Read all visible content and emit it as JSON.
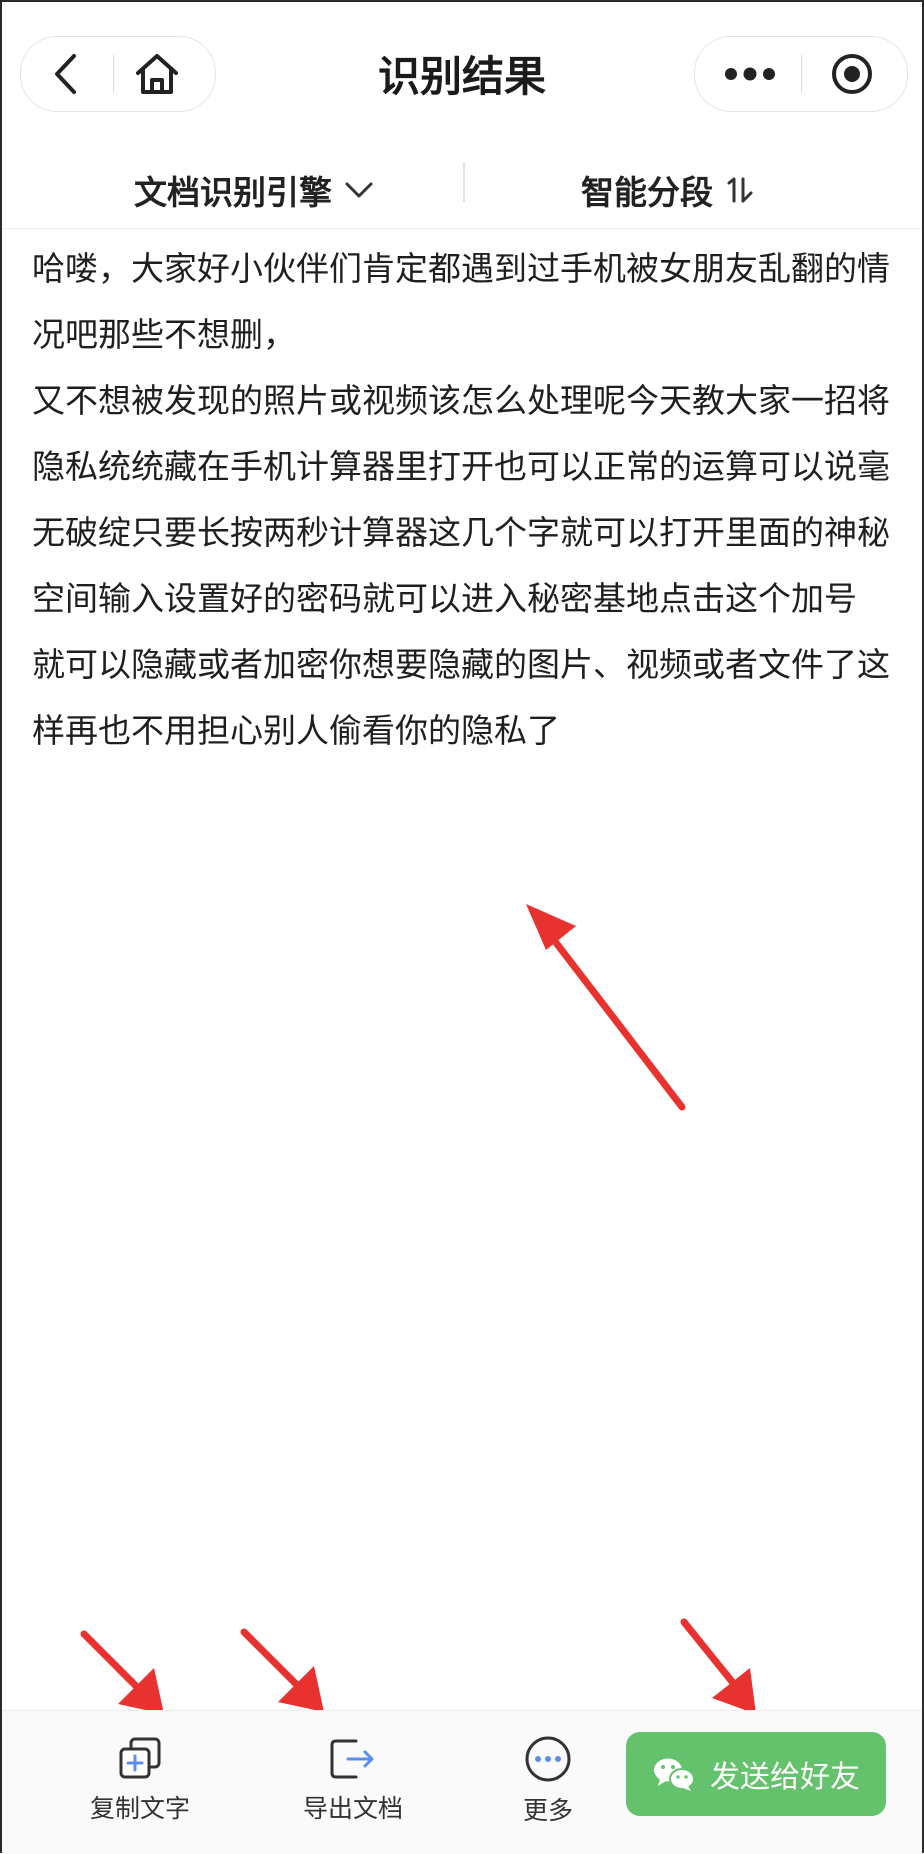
{
  "header": {
    "title": "识别结果",
    "left_icons": [
      "back-arrow-icon",
      "home-icon"
    ],
    "right_icons": [
      "more-dots-icon",
      "target-icon"
    ]
  },
  "toolbar": {
    "engine_label": "文档识别引擎",
    "engine_icon": "chevron-down-icon",
    "segment_label": "智能分段",
    "segment_icon": "sort-toggle-icon"
  },
  "content": {
    "paragraphs": [
      "哈喽，大家好小伙伴们肯定都遇到过手机被女朋友乱翻的情况吧那些不想删，",
      "又不想被发现的照片或视频该怎么处理呢今天教大家一招将隐私统统藏在手机计算器里打开也可以正常的运算可以说毫无破绽只要长按两秒计算器这几个字就可以打开里面的神秘空间输入设置好的密码就可以进入秘密基地点击这个加号",
      "就可以隐藏或者加密你想要隐藏的图片、视频或者文件了这样再也不用担心别人偷看你的隐私了"
    ]
  },
  "bottom_bar": {
    "copy_label": "复制文字",
    "copy_icon": "copy-plus-icon",
    "export_label": "导出文档",
    "export_icon": "export-doc-icon",
    "more_label": "更多",
    "more_icon": "more-circle-icon",
    "send_label": "发送给好友",
    "send_icon": "wechat-icon"
  },
  "colors": {
    "annotation_arrow": "#e8322f",
    "send_button": "#63c26b",
    "icon_accent": "#5a8df0"
  }
}
